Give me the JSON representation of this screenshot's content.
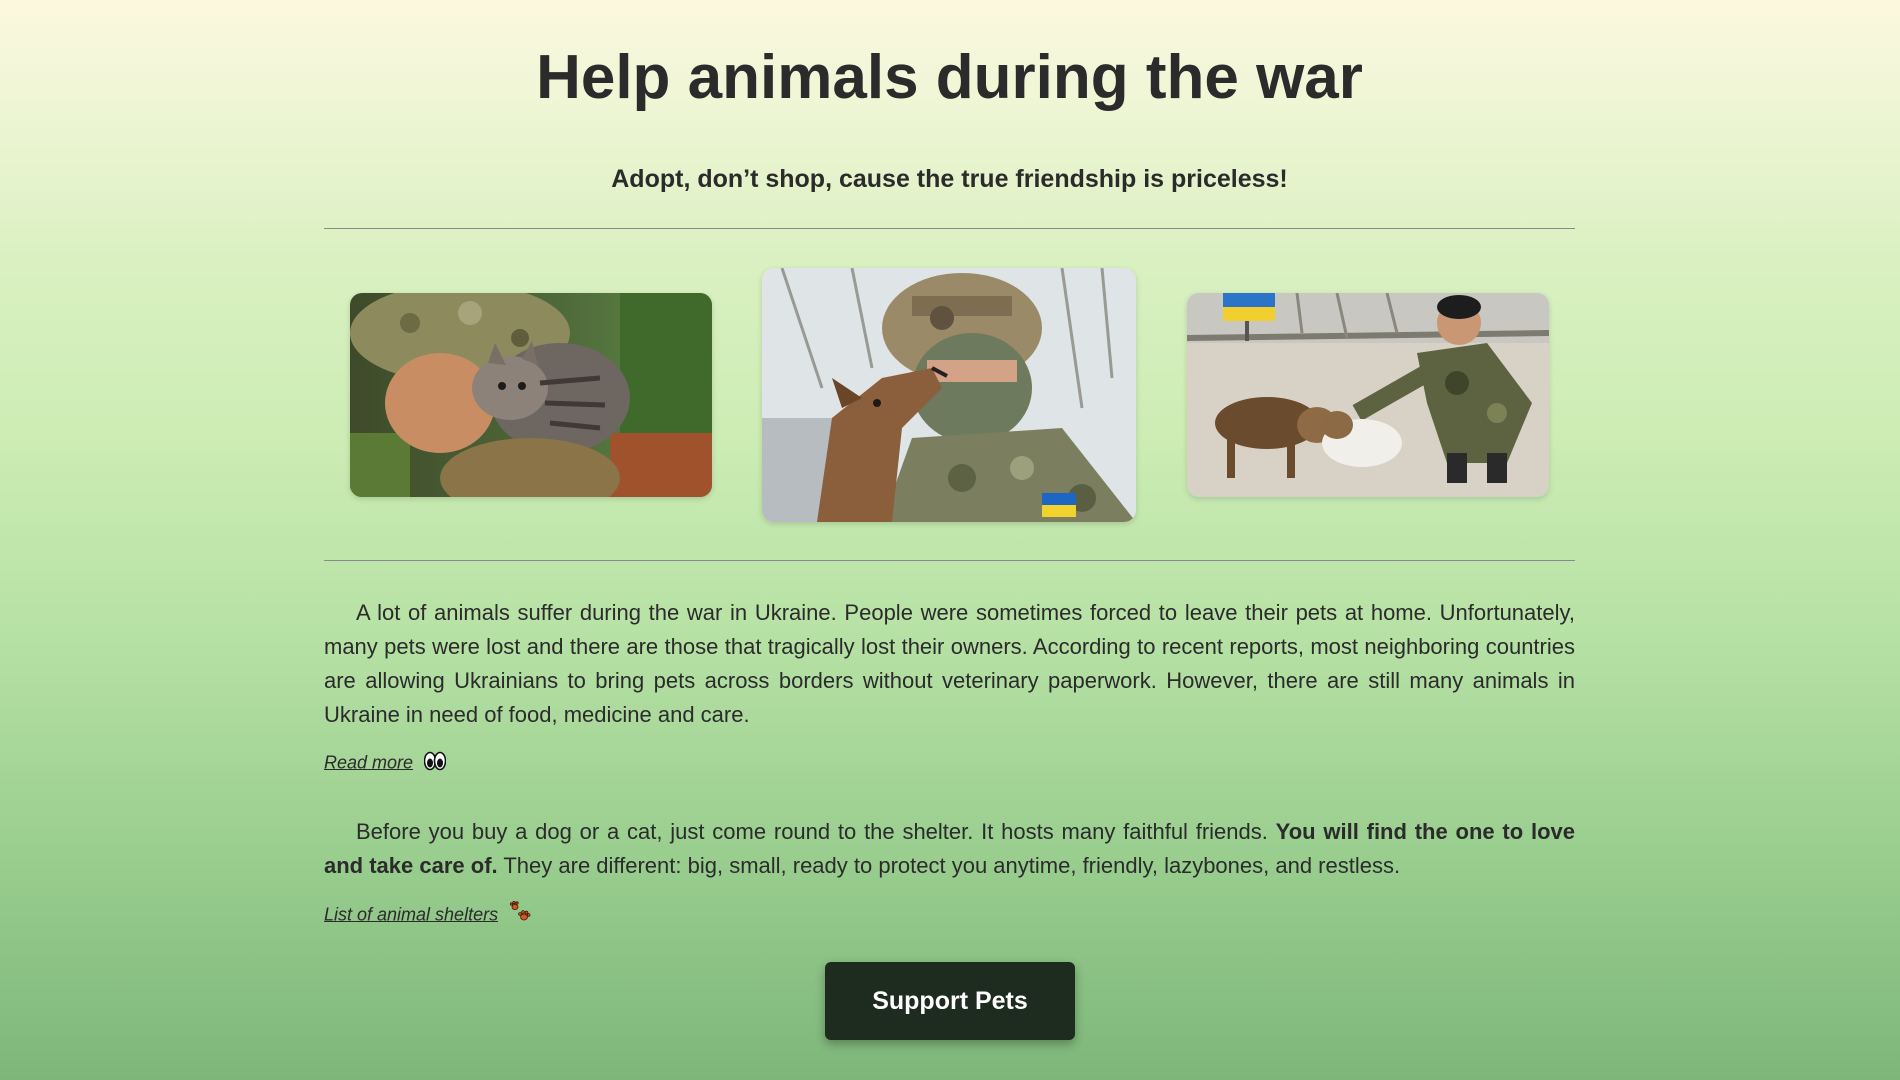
{
  "header": {
    "title": "Help animals during the war",
    "subtitle": "Adopt, don’t shop, cause the true friendship is priceless!"
  },
  "gallery": {
    "images": [
      {
        "name": "soldier-with-kitten"
      },
      {
        "name": "soldier-with-dog-kiss"
      },
      {
        "name": "soldier-petting-dogs"
      }
    ]
  },
  "content": {
    "paragraph1": "A lot of animals suffer during the war in Ukraine. People were sometimes forced to leave their pets at home. Unfortunately, many pets were lost and there are those that tragically lost their owners. According to recent reports, most neighboring countries are allowing Ukrainians to bring pets across borders without veterinary paperwork. However, there are still many animals in Ukraine in need of food, medicine and care.",
    "read_more_link": "Read more",
    "read_more_icon": "eyes-icon",
    "paragraph2_start": "Before you buy a dog or a cat, just come round to the shelter. It hosts many faithful friends. ",
    "paragraph2_bold": "You will find the one to love and take care of.",
    "paragraph2_end": " They are different: big, small, ready to protect you anytime, friendly, lazybones, and restless.",
    "shelters_link": "List of animal shelters",
    "shelters_icon": "paw-prints-icon"
  },
  "cta": {
    "button_label": "Support Pets"
  },
  "colors": {
    "background_top": "#fbf8de",
    "background_bottom": "#7eb67a",
    "text": "#2b2b2b",
    "button": "#1e2b1f",
    "button_text": "#ffffff"
  }
}
